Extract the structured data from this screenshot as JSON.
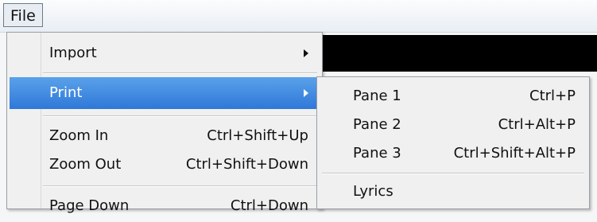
{
  "menubar": {
    "file": "File"
  },
  "file_menu": {
    "items": [
      {
        "label": "Import",
        "has_submenu": true
      },
      {
        "label": "Print",
        "has_submenu": true,
        "selected": true
      },
      {
        "label": "Zoom In",
        "shortcut": "Ctrl+Shift+Up"
      },
      {
        "label": "Zoom Out",
        "shortcut": "Ctrl+Shift+Down"
      },
      {
        "label": "Page Down",
        "shortcut": "Ctrl+Down"
      }
    ]
  },
  "print_submenu": {
    "items": [
      {
        "label": "Pane 1",
        "shortcut": "Ctrl+P"
      },
      {
        "label": "Pane 2",
        "shortcut": "Ctrl+Alt+P"
      },
      {
        "label": "Pane 3",
        "shortcut": "Ctrl+Shift+Alt+P"
      },
      {
        "label": "Lyrics"
      }
    ]
  },
  "colors": {
    "selection": "#3a86e0",
    "menu_bg": "#f0f0f0"
  }
}
